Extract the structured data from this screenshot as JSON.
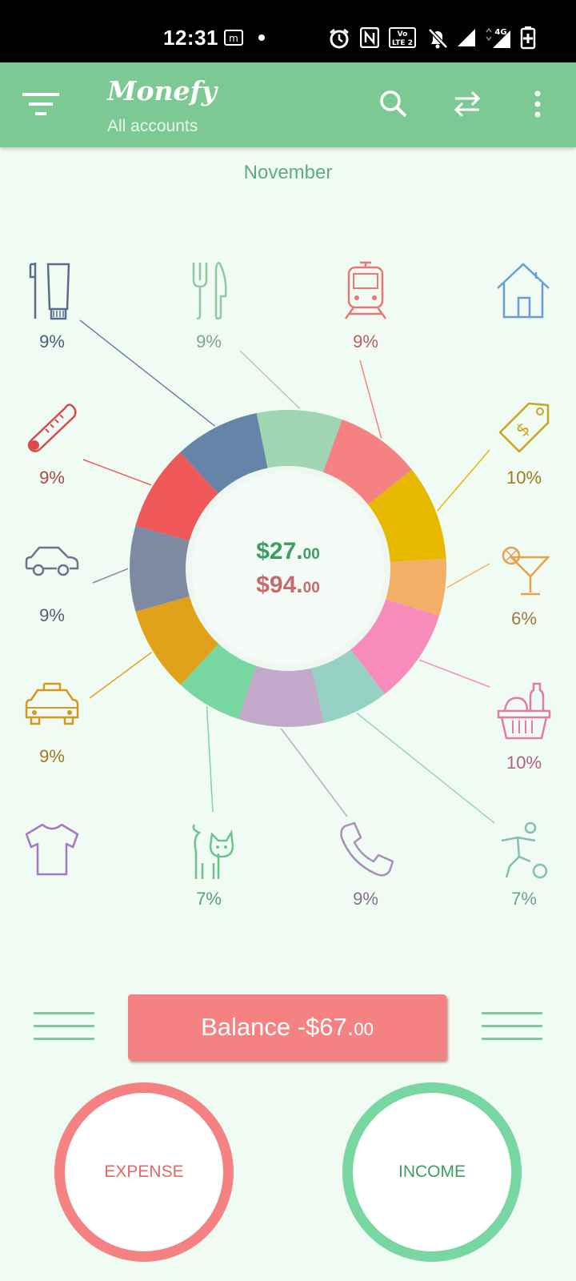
{
  "status_bar": {
    "time": "12:31",
    "network": "4G"
  },
  "app_bar": {
    "title": "Monefy",
    "subtitle": "All accounts"
  },
  "period": "November",
  "categories": [
    {
      "name": "toiletry",
      "icon": "toothbrush-toothpaste-icon",
      "percent": "9%",
      "color": "#566e8c"
    },
    {
      "name": "eating-out",
      "icon": "fork-knife-icon",
      "percent": "9%",
      "color": "#8fc9a3"
    },
    {
      "name": "transport",
      "icon": "train-icon",
      "percent": "9%",
      "color": "#ea7676"
    },
    {
      "name": "house",
      "icon": "house-icon",
      "percent": "",
      "color": "#6aa0d0"
    },
    {
      "name": "health",
      "icon": "thermometer-icon",
      "percent": "9%",
      "color": "#d64c4c"
    },
    {
      "name": "gifts",
      "icon": "price-tag-icon",
      "percent": "10%",
      "color": "#c9a521"
    },
    {
      "name": "car",
      "icon": "car-icon",
      "percent": "9%",
      "color": "#69768c"
    },
    {
      "name": "entertainment",
      "icon": "cocktail-icon",
      "percent": "6%",
      "color": "#e9a04a"
    },
    {
      "name": "taxi",
      "icon": "taxi-icon",
      "percent": "9%",
      "color": "#d49a1e"
    },
    {
      "name": "food",
      "icon": "grocery-basket-icon",
      "percent": "10%",
      "color": "#e37aa8"
    },
    {
      "name": "clothes",
      "icon": "tshirt-icon",
      "percent": "",
      "color": "#a878c0"
    },
    {
      "name": "pets",
      "icon": "cat-icon",
      "percent": "7%",
      "color": "#6cc38b"
    },
    {
      "name": "communications",
      "icon": "phone-icon",
      "percent": "9%",
      "color": "#a78fb5"
    },
    {
      "name": "sports",
      "icon": "soccer-player-icon",
      "percent": "7%",
      "color": "#82bfb2"
    }
  ],
  "chart_data": {
    "type": "pie",
    "style": "donut",
    "categories": [
      "eating-out",
      "transport",
      "gifts",
      "entertainment",
      "food",
      "sports",
      "communications",
      "pets",
      "taxi",
      "car",
      "health",
      "toiletry"
    ],
    "values": [
      9,
      9,
      10,
      6,
      10,
      7,
      9,
      7,
      9,
      9,
      9,
      9
    ],
    "colors": [
      "#9fd5b2",
      "#f58282",
      "#e6b800",
      "#f2b066",
      "#f78cbc",
      "#96d1c4",
      "#c2a8c9",
      "#78d6a0",
      "#e0a21b",
      "#7d8aa1",
      "#ee5858",
      "#6484a8"
    ]
  },
  "summary": {
    "income_main": "$27.",
    "income_cents": "00",
    "expense_main": "$94.",
    "expense_cents": "00"
  },
  "balance": {
    "label": "Balance -$67.",
    "cents": "00"
  },
  "buttons": {
    "expense": "EXPENSE",
    "income": "INCOME"
  }
}
